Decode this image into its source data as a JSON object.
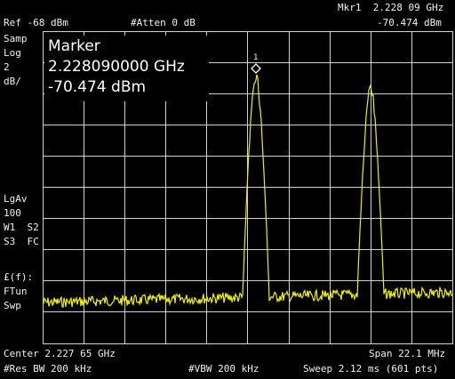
{
  "header": {
    "marker_readout_freq": "Mkr1  2.228 09 GHz",
    "reference_level": "Ref -68 dBm",
    "attenuation": "#Atten 0 dB",
    "marker_readout_amp": "-70.474 dBm"
  },
  "left_panel": {
    "detector": "Samp",
    "scale_type": "Log",
    "scale_value": "2",
    "scale_unit": "dB/",
    "averaging": "LgAv",
    "average_count": "100",
    "trace_line1": "W1  S2",
    "trace_line2": "S3  FC",
    "function": "£(f):",
    "function_mode": "FTun",
    "sweep_label": "Swp"
  },
  "marker_box": {
    "title": "Marker",
    "frequency": "2.228090000 GHz",
    "amplitude": "-70.474 dBm",
    "marker_number": "1"
  },
  "footer": {
    "center": "Center 2.227 65 GHz",
    "span": "Span 22.1 MHz",
    "res_bw": "#Res BW 200 kHz",
    "vbw": "#VBW 200 kHz",
    "sweep": "Sweep 2.12 ms (601 pts)"
  },
  "colors": {
    "trace": "#f0f000",
    "grid": "#cfcfcf",
    "background": "#000000",
    "text": "#f0f0f0"
  }
}
